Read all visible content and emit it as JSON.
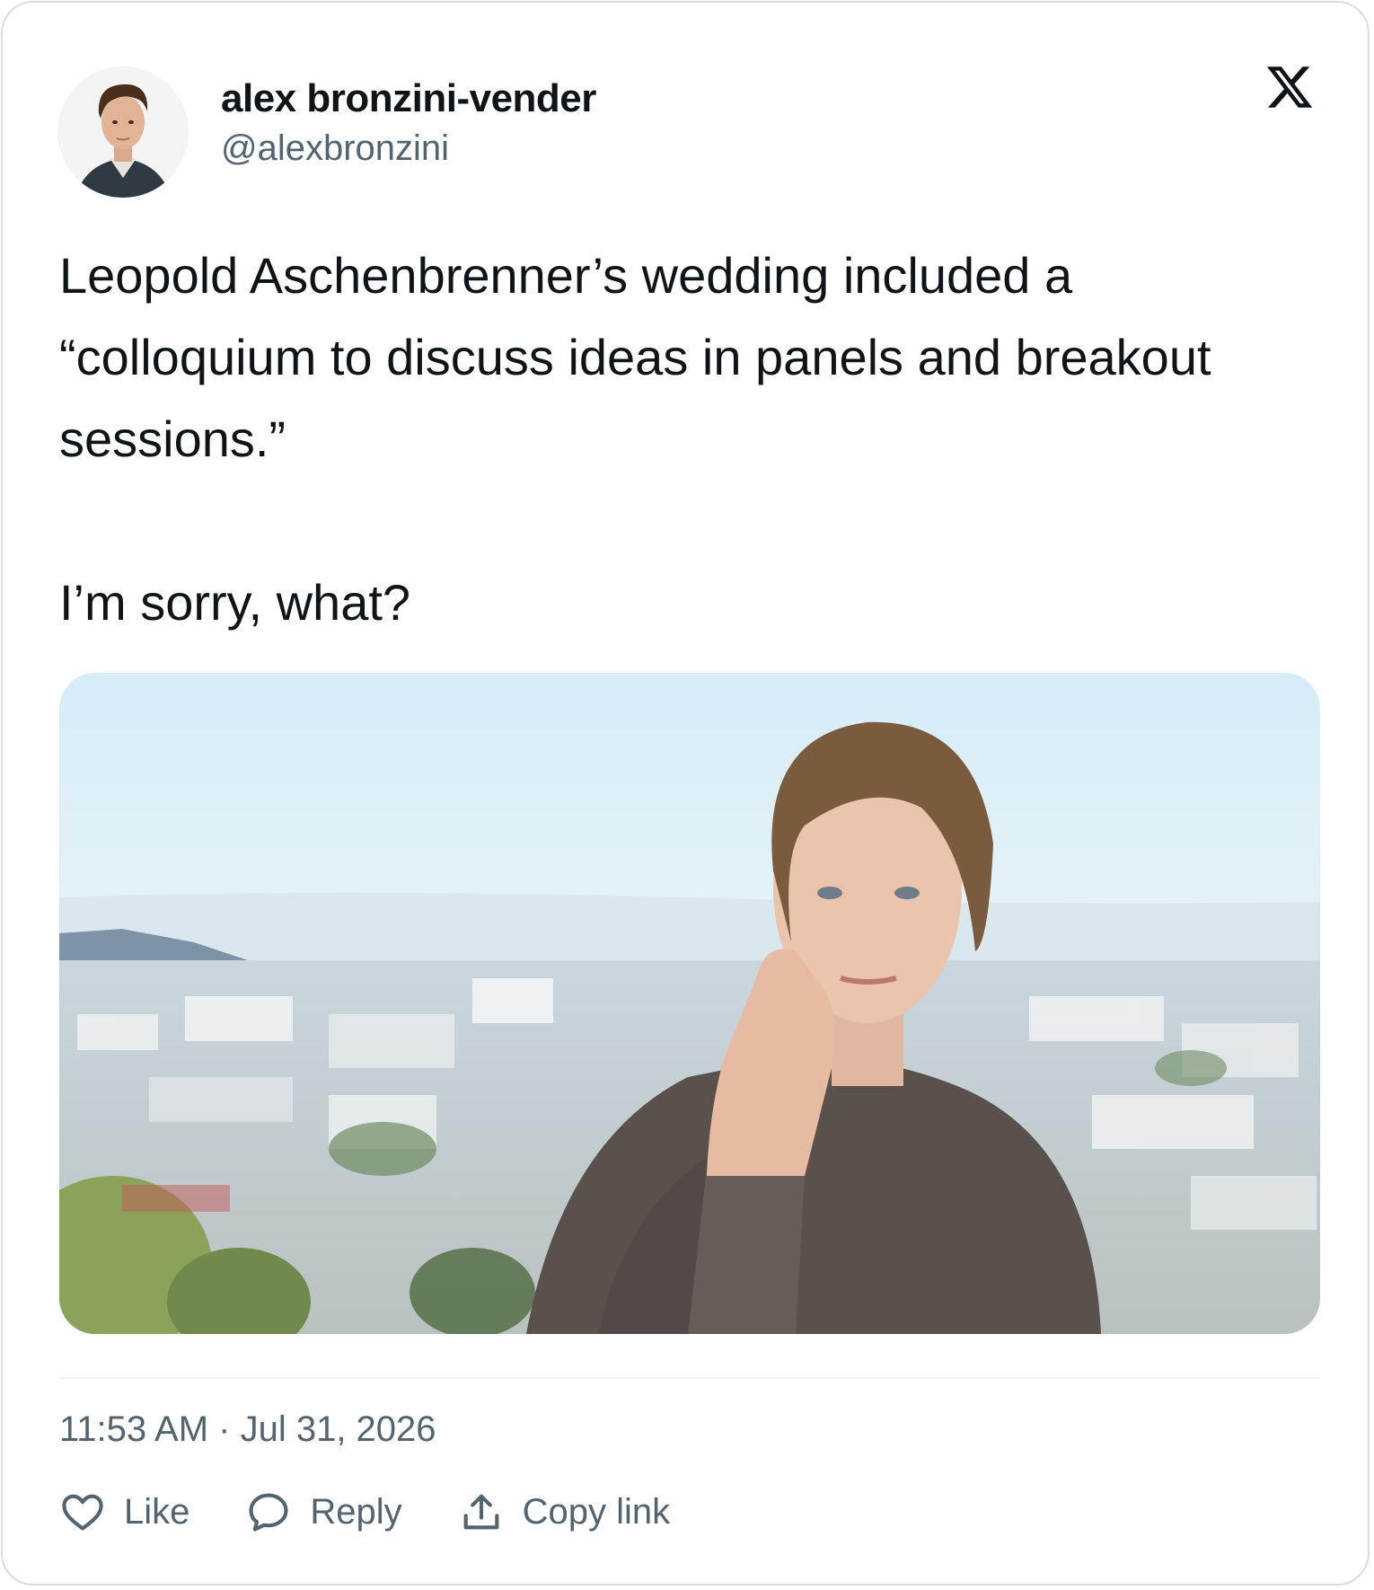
{
  "author": {
    "display_name": "alex bronzini-vender",
    "handle": "@alexbronzini",
    "avatar_icon": "user-avatar-photo"
  },
  "brand": {
    "logo_icon": "x-logo-icon",
    "color": "#0f1419"
  },
  "tweet": {
    "line1": "Leopold Aschenbrenner’s wedding included a “colloquium to discuss ideas in panels and breakout sessions.”",
    "line2": "I’m sorry, what?",
    "media_description_icon": "photo-man-sweater-city-view"
  },
  "meta": {
    "timestamp": "11:53 AM · Jul 31, 2026"
  },
  "actions": [
    {
      "label": "Like",
      "icon": "heart-icon"
    },
    {
      "label": "Reply",
      "icon": "speech-bubble-icon"
    },
    {
      "label": "Copy link",
      "icon": "upload-icon"
    }
  ],
  "colors": {
    "text_primary": "#0f1419",
    "text_secondary": "#536471",
    "border": "#d9dde1"
  }
}
